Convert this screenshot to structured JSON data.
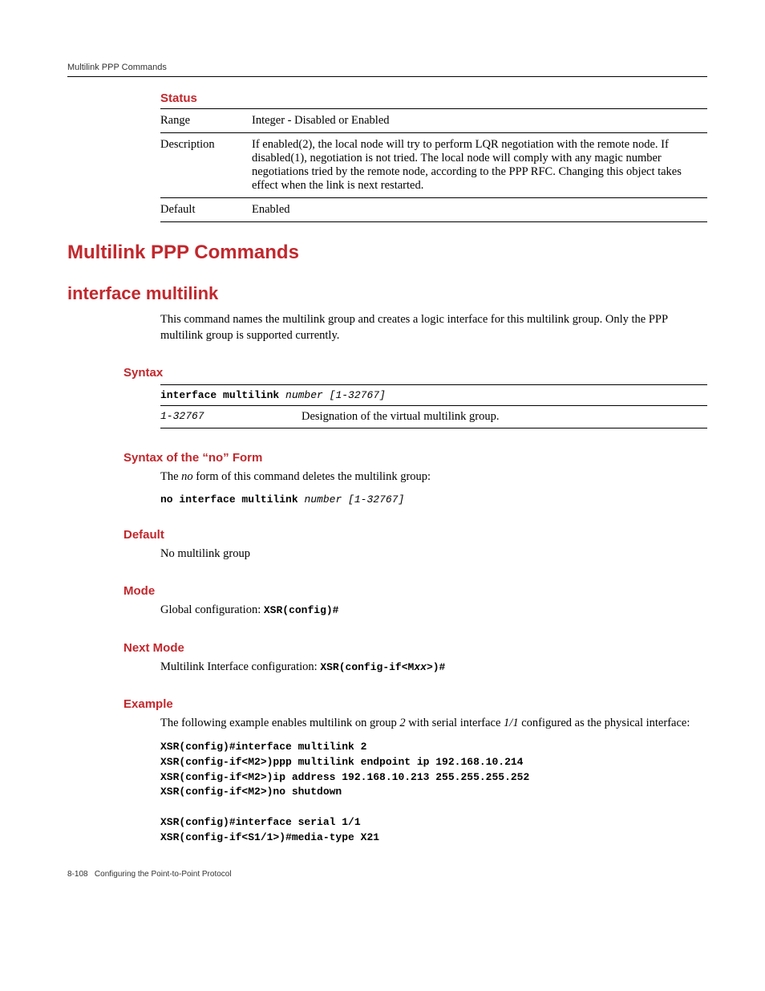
{
  "header": {
    "running_head": "Multilink PPP Commands"
  },
  "status_table": {
    "title": "Status",
    "rows": [
      {
        "label": "Range",
        "value": "Integer - Disabled or Enabled"
      },
      {
        "label": "Description",
        "value": "If enabled(2), the local node will try to perform LQR negotiation with the remote node. If disabled(1), negotiation is not tried. The local node will comply with any magic number negotiations tried by the remote node, according to the PPP RFC. Changing this object takes effect when the link is next restarted."
      },
      {
        "label": "Default",
        "value": "Enabled"
      }
    ]
  },
  "h1": "Multilink PPP Commands",
  "h2": "interface multilink",
  "intro": "This command names the multilink group and creates a logic interface for this multilink group. Only the PPP multilink group is supported currently.",
  "syntax": {
    "heading": "Syntax",
    "line_cmd": "interface multilink ",
    "line_args": "number [1-32767]",
    "param_name": "1-32767",
    "param_desc": "Designation of the virtual multilink group."
  },
  "no_form": {
    "heading": "Syntax of the “no” Form",
    "body_prefix": "The ",
    "body_ital": "no",
    "body_suffix": " form of this command deletes the multilink group:",
    "line_cmd": "no interface multilink ",
    "line_args": "number [1-32767]"
  },
  "default_sec": {
    "heading": "Default",
    "body": "No multilink group"
  },
  "mode_sec": {
    "heading": "Mode",
    "body_prefix": "Global configuration: ",
    "body_code": "XSR(config)#"
  },
  "next_mode_sec": {
    "heading": "Next Mode",
    "body_prefix": "Multilink Interface configuration: ",
    "body_code_pre": "XSR(config-if<M",
    "body_code_ital": "xx",
    "body_code_post": ">)#"
  },
  "example": {
    "heading": "Example",
    "body_prefix": "The following example enables multilink on group ",
    "body_i1": "2",
    "body_mid": " with serial interface ",
    "body_i2": "1/1",
    "body_suffix": " configured as the physical interface:",
    "code": "XSR(config)#interface multilink 2\nXSR(config-if<M2>)ppp multilink endpoint ip 192.168.10.214\nXSR(config-if<M2>)ip address 192.168.10.213 255.255.255.252\nXSR(config-if<M2>)no shutdown\n\nXSR(config)#interface serial 1/1\nXSR(config-if<S1/1>)#media-type X21"
  },
  "footer": {
    "page": "8-108",
    "title": "Configuring the Point-to-Point Protocol"
  }
}
